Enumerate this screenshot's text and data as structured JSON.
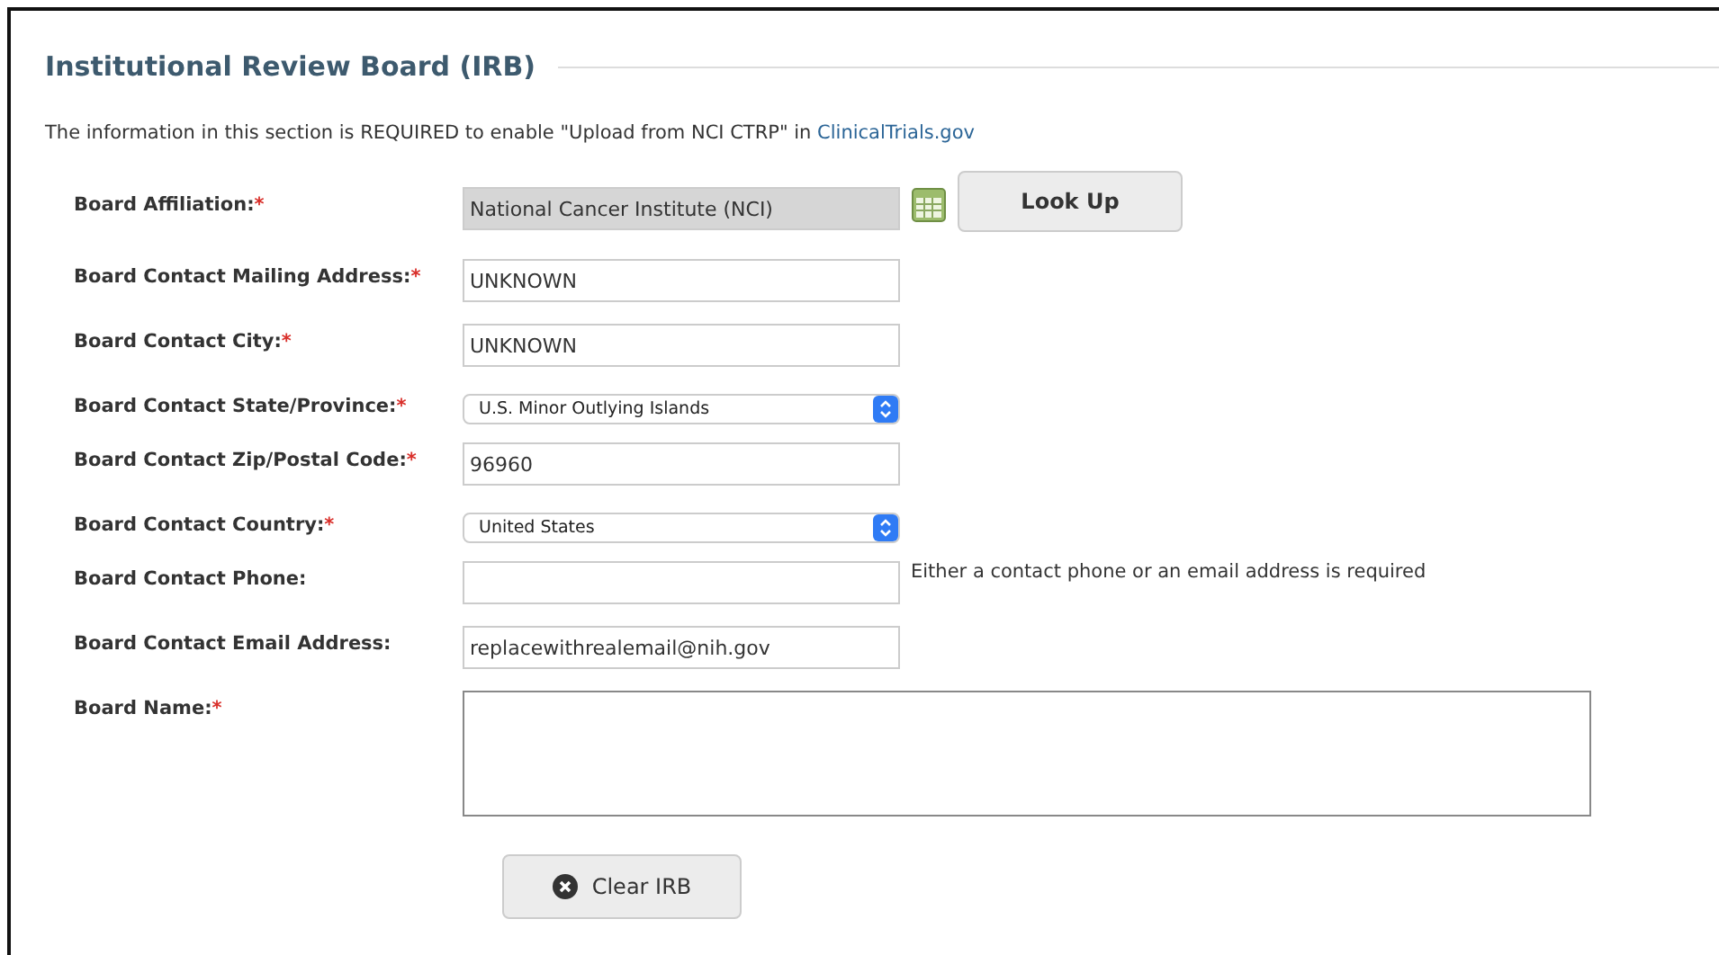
{
  "section": {
    "title": "Institutional Review Board (IRB)",
    "intro": "The information in this section is REQUIRED to enable \"Upload from NCI CTRP\" in",
    "intro_link": "ClinicalTrials.gov"
  },
  "fields": [
    {
      "kind": "readonly",
      "label": "Board Affiliation:",
      "required_mark": "*",
      "value": "National Cancer Institute (NCI)",
      "button": "Look Up"
    },
    {
      "kind": "text",
      "label": "Board Contact Mailing Address:",
      "required_mark": "*",
      "value": "UNKNOWN"
    },
    {
      "kind": "text",
      "label": "Board Contact City:",
      "required_mark": "*",
      "value": "UNKNOWN"
    },
    {
      "kind": "select",
      "label": "Board Contact State/Province:",
      "required_mark": "*",
      "value": "U.S. Minor Outlying Islands"
    },
    {
      "kind": "text",
      "label": "Board Contact Zip/Postal Code:",
      "required_mark": "*",
      "value": "96960"
    },
    {
      "kind": "select",
      "label": "Board Contact Country:",
      "required_mark": "*",
      "value": "United States"
    },
    {
      "kind": "text",
      "label": "Board Contact Phone:",
      "hint": "Either a contact phone or an email address is required"
    },
    {
      "kind": "text",
      "label": "Board Contact Email Address:",
      "value": "replacewithrealemail@nih.gov"
    },
    {
      "kind": "textarea",
      "label": "Board Name:",
      "required_mark": "*"
    }
  ],
  "clear_button": "Clear IRB"
}
